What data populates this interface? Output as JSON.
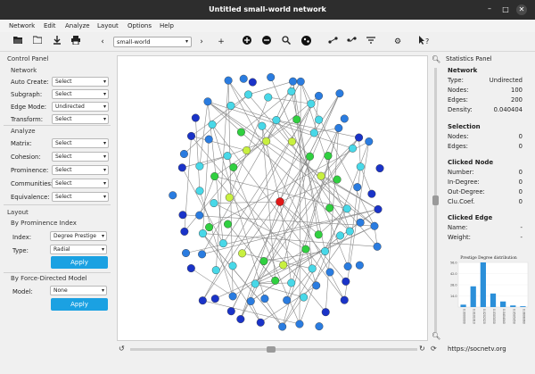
{
  "window": {
    "title": "Untitled small-world network",
    "min": "–",
    "max": "□",
    "close": "✕"
  },
  "menubar": [
    "Network",
    "Edit",
    "Analyze",
    "Layout",
    "Options",
    "Help"
  ],
  "toolbar": {
    "network_combo": "small-world",
    "icons": [
      "open-folder-icon",
      "folder-icon",
      "download-icon",
      "print-icon",
      "prev-icon",
      "next-icon",
      "add-icon",
      "zoom-in-icon",
      "zoom-out-icon",
      "search-icon",
      "palette-icon",
      "edge-add-icon",
      "edge-remove-icon",
      "filter-icon",
      "settings-icon",
      "whatsthis-icon"
    ]
  },
  "control_panel": {
    "title": "Control Panel",
    "network": {
      "header": "Network",
      "rows": [
        {
          "label": "Auto Create:",
          "value": "Select"
        },
        {
          "label": "Subgraph:",
          "value": "Select"
        },
        {
          "label": "Edge Mode:",
          "value": "Undirected"
        },
        {
          "label": "Transform:",
          "value": "Select"
        }
      ]
    },
    "analyze": {
      "header": "Analyze",
      "rows": [
        {
          "label": "Matrix:",
          "value": "Select"
        },
        {
          "label": "Cohesion:",
          "value": "Select"
        },
        {
          "label": "Prominence:",
          "value": "Select"
        },
        {
          "label": "Communities:",
          "value": "Select"
        },
        {
          "label": "Equivalence:",
          "value": "Select"
        }
      ]
    },
    "layout": {
      "header": "Layout",
      "by_prominence": {
        "header": "By Prominence Index",
        "index_label": "Index:",
        "index_value": "Degree Prestige",
        "type_label": "Type:",
        "type_value": "Radial",
        "apply": "Apply"
      },
      "by_force": {
        "header": "By Force-Directed Model",
        "model_label": "Model:",
        "model_value": "None",
        "apply": "Apply"
      }
    }
  },
  "stats_panel": {
    "title": "Statistics Panel",
    "network": {
      "header": "Network",
      "rows": [
        {
          "k": "Type:",
          "v": "Undirected"
        },
        {
          "k": "Nodes:",
          "v": "100"
        },
        {
          "k": "Edges:",
          "v": "200"
        },
        {
          "k": "Density:",
          "v": "0.040404"
        }
      ]
    },
    "selection": {
      "header": "Selection",
      "rows": [
        {
          "k": "Nodes:",
          "v": "0"
        },
        {
          "k": "Edges:",
          "v": "0"
        }
      ]
    },
    "clicked_node": {
      "header": "Clicked Node",
      "rows": [
        {
          "k": "Number:",
          "v": "0"
        },
        {
          "k": "In-Degree:",
          "v": "0"
        },
        {
          "k": "Out-Degree:",
          "v": "0"
        },
        {
          "k": "Clu.Coef.",
          "v": "0"
        }
      ]
    },
    "clicked_edge": {
      "header": "Clicked Edge",
      "rows": [
        {
          "k": "Name:",
          "v": "-"
        },
        {
          "k": "Weight:",
          "v": "-"
        }
      ]
    },
    "url": "https://socnetv.org"
  },
  "colors": {
    "accent": "#1ba1e2",
    "node_dark": "#1a33c8",
    "node_mid": "#2a7ce0",
    "node_cyan": "#48d8e8",
    "node_green": "#30d040",
    "node_yellow": "#c8f040",
    "node_red": "#e01818",
    "bar": "#2b8fd9"
  },
  "chart_data": {
    "type": "bar",
    "title": "Prestige Degree distribution",
    "categories": [
      "0.0000000",
      "0.0101010",
      "0.0202020",
      "0.0303030",
      "0.0404040",
      "0.0505050",
      "0.0606060"
    ],
    "values": [
      3,
      26,
      56,
      17,
      7,
      2,
      1
    ],
    "ylim": [
      0,
      56
    ],
    "yticks": [
      "56.0",
      "42.0",
      "28.0",
      "14.0"
    ]
  }
}
